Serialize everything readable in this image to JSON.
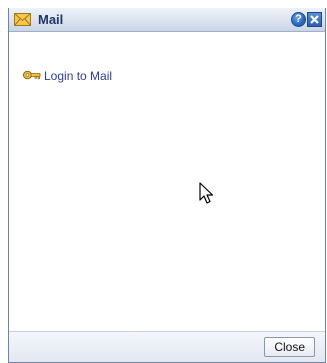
{
  "window": {
    "title": "Mail",
    "title_icon": "envelope-icon",
    "help_label": "?",
    "close_icon": "close-x-icon"
  },
  "content": {
    "login_link": {
      "icon": "key-icon",
      "label": "Login to Mail"
    }
  },
  "footer": {
    "close_label": "Close"
  },
  "colors": {
    "titlebar_text": "#1f3565",
    "link": "#2d3ca6",
    "border": "#6f83a6"
  }
}
